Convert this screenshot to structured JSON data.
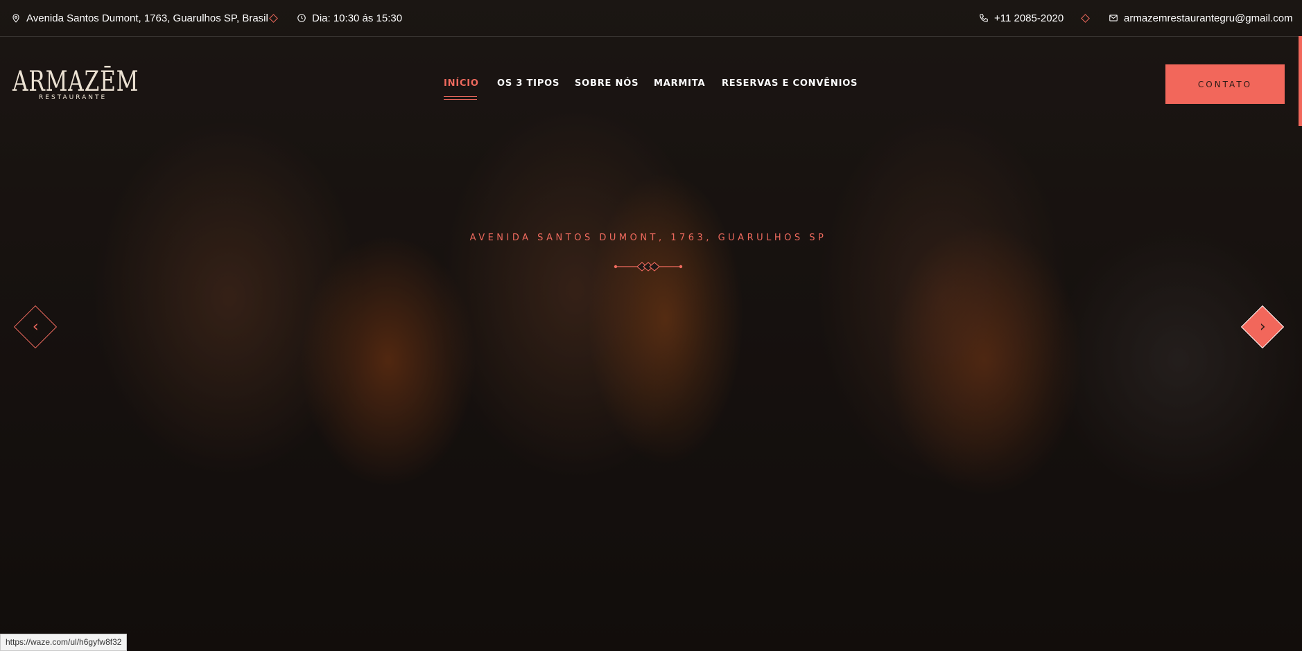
{
  "topbar": {
    "address": "Avenida Santos Dumont, 1763, Guarulhos SP, Brasil",
    "hours": "Dia: 10:30 ás 15:30",
    "phone": "+11 2085-2020",
    "email": "armazemrestaurantegru@gmail.com"
  },
  "logo": {
    "name": "ARMAZĒM",
    "subtitle": "RESTAURANTE"
  },
  "nav": {
    "items": [
      {
        "label": "INÍCIO",
        "active": true
      },
      {
        "label": "OS 3 TIPOS",
        "active": false
      },
      {
        "label": "SOBRE NÓS",
        "active": false
      },
      {
        "label": "MARMITA",
        "active": false
      },
      {
        "label": "RESERVAS E CONVÊNIOS",
        "active": false
      }
    ],
    "contact_label": "CONTATO"
  },
  "hero": {
    "subtitle": "AVENIDA SANTOS DUMONT, 1763, GUARULHOS SP",
    "prev_icon": "chevron-left-icon",
    "next_icon": "chevron-right-icon"
  },
  "status": {
    "url": "https://waze.com/ul/h6gyfw8f32"
  },
  "colors": {
    "accent": "#f2675b",
    "text": "#ffffff"
  }
}
